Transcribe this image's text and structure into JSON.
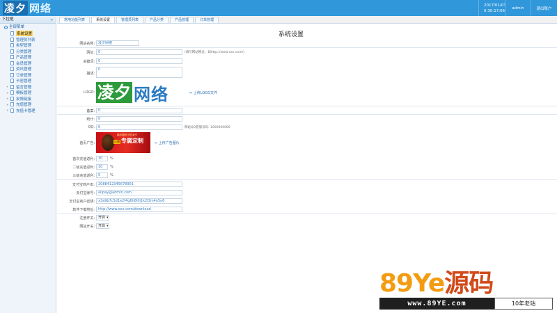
{
  "header": {
    "logo_mark": "凌夕",
    "logo_word": "网络",
    "date": "2017/01/03",
    "time": "0:30:17:06",
    "user": "admin",
    "logout_label": "退出账户"
  },
  "sidebar": {
    "title": "下拉框",
    "collapse_glyph": "«",
    "group": "全部菜单",
    "items": [
      {
        "label": "系统设置",
        "active": true
      },
      {
        "label": "管理员列表"
      },
      {
        "label": "类型管理"
      },
      {
        "label": "分类管理"
      },
      {
        "label": "产品管理"
      },
      {
        "label": "会员管理"
      },
      {
        "label": "资讯管理"
      },
      {
        "label": "订单管理"
      },
      {
        "label": "卡密管理"
      },
      {
        "label": "留言管理"
      },
      {
        "label": "模板管理"
      },
      {
        "label": "友情链接"
      },
      {
        "label": "充值管理"
      },
      {
        "label": "充值卡管理"
      }
    ]
  },
  "tabs": [
    {
      "label": "常用功能列表"
    },
    {
      "label": "系统设置",
      "active": true
    },
    {
      "label": "管理员列表"
    },
    {
      "label": "产品分类"
    },
    {
      "label": "产品管理"
    },
    {
      "label": "订单管理"
    }
  ],
  "page_title": "系统设置",
  "form": {
    "site_name": {
      "label": "网站名称:",
      "value": "凌夕网络"
    },
    "url": {
      "label": "网址:",
      "value": "0",
      "hint": "(填写网站网址，如http://www.xxx.com/)"
    },
    "keywords": {
      "label": "关键词:",
      "value": "0"
    },
    "desc": {
      "label": "描述:",
      "value": "0"
    },
    "logo": {
      "label": "LOGO:",
      "upload": "上传LOGO文件",
      "mark": "凌夕",
      "word": "网络"
    },
    "icp": {
      "label": "备案:",
      "value": "0"
    },
    "stat": {
      "label": "统计:",
      "value": "0"
    },
    "qq": {
      "label": "QQ:",
      "value": "0",
      "hint": "网站QQ客服号码: 1000000000"
    },
    "ad": {
      "label": "首页广告:",
      "upload": "上传广告图片",
      "banner_top": "精品源码 尽在凌夕",
      "banner_main": "专属定制",
      "banner_pill": "火爆"
    },
    "first_rebate": {
      "label": "首次充值返利:",
      "value": "30",
      "unit": "%"
    },
    "second_rebate": {
      "label": "二级充值返利:",
      "value": "10",
      "unit": "%"
    },
    "third_rebate": {
      "label": "三级充值返利:",
      "value": "5",
      "unit": "%"
    },
    "pay_id": {
      "label": "支付宝商户ID:",
      "value": "2088412345678901"
    },
    "alipay_account": {
      "label": "支付宝账号:",
      "value": "alipay@admin.com"
    },
    "alipay_key": {
      "label": "支付宝商户密钥:",
      "value": "x3a9b7c5d1e2f4g6h8i0j1k2l3m4n5o6"
    },
    "download_url": {
      "label": "软件下载地址:",
      "value": "http://www.xxx.com/download"
    },
    "reg_switch": {
      "label": "注册开关:",
      "value": "开启"
    },
    "site_switch": {
      "label": "网站开关:",
      "value": "开启"
    }
  },
  "watermark": {
    "brand_digits": "89",
    "brand_latin": "Ye",
    "brand_cn": "源码",
    "url": "www.89YE.com",
    "tag": "10年老站"
  }
}
